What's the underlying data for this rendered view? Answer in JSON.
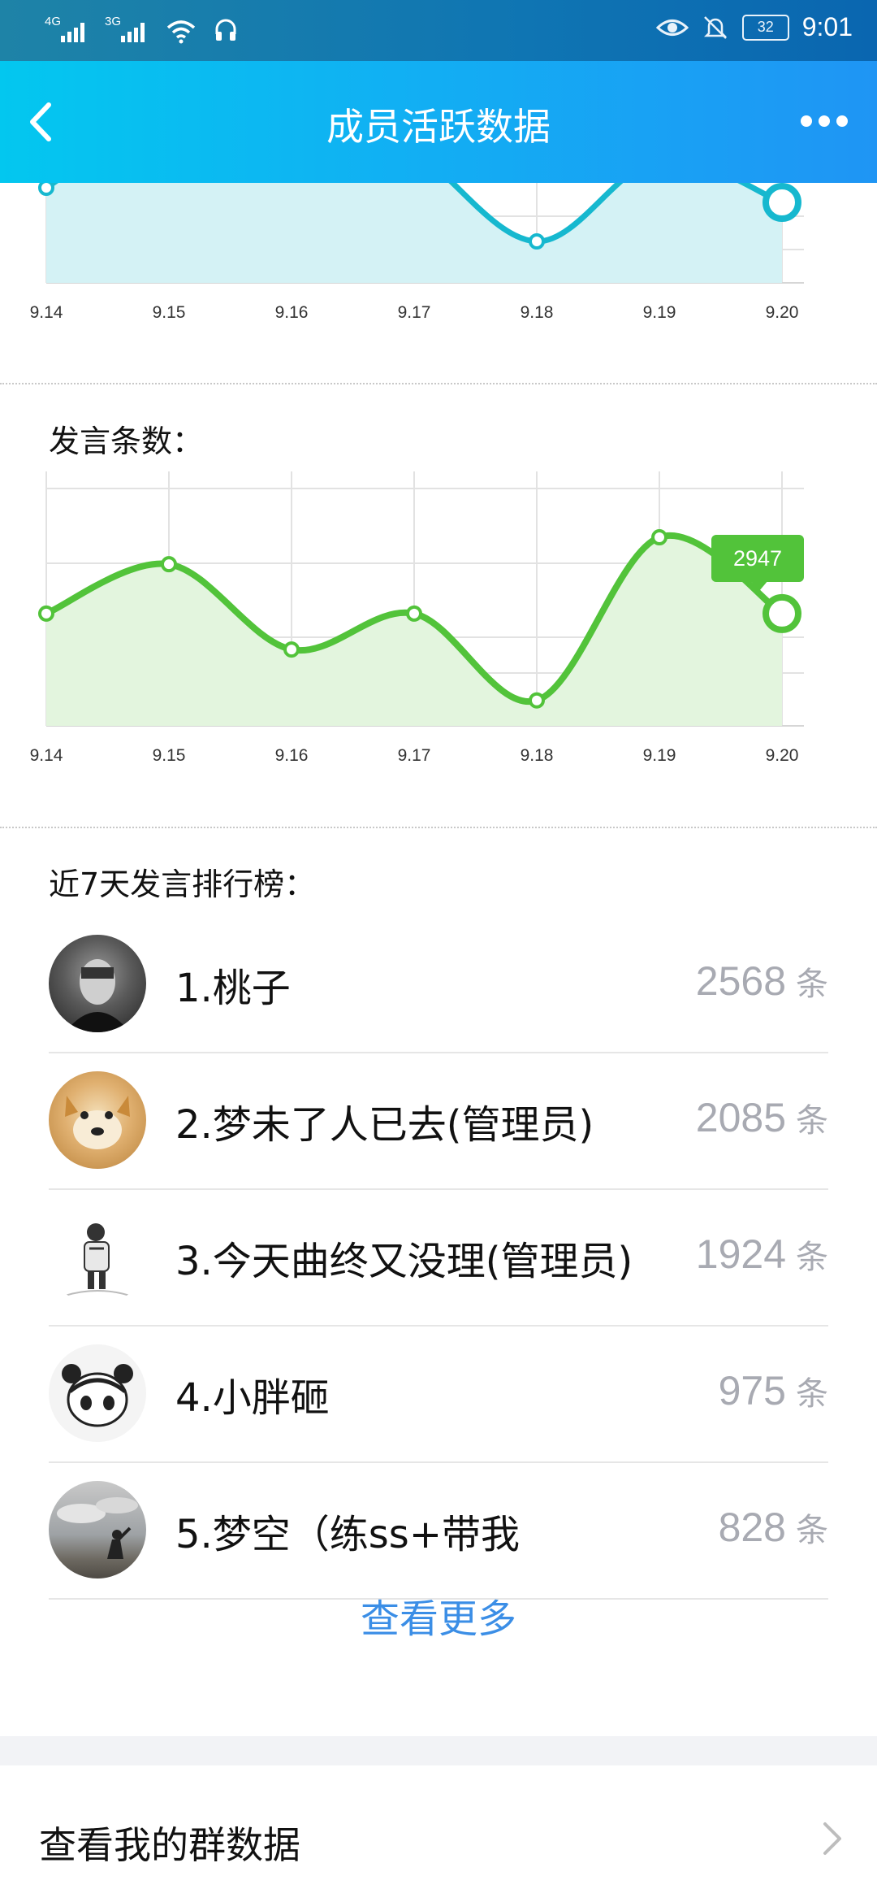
{
  "status_bar": {
    "sim1": "4G",
    "sim2": "3G",
    "battery": "32",
    "time": "9:01"
  },
  "header": {
    "title": "成员活跃数据"
  },
  "charts": {
    "x_labels": [
      "9.14",
      "9.15",
      "9.16",
      "9.17",
      "9.18",
      "9.19",
      "9.20"
    ]
  },
  "chart_data": [
    {
      "type": "area",
      "title": "",
      "categories": [
        "9.14",
        "9.15",
        "9.16",
        "9.17",
        "9.18",
        "9.19",
        "9.20"
      ],
      "partially_visible": true,
      "series": [
        {
          "values": [
            null,
            null,
            null,
            null,
            null,
            null,
            null
          ]
        }
      ],
      "colors": {
        "line": "#16b8cf",
        "fill": "#d4f2f5"
      }
    },
    {
      "type": "area",
      "title": "发言条数：",
      "categories": [
        "9.14",
        "9.15",
        "9.16",
        "9.17",
        "9.18",
        "9.19",
        "9.20"
      ],
      "series": [
        {
          "values": [
            2500,
            2830,
            2260,
            2500,
            1920,
            3010,
            2500
          ]
        }
      ],
      "highlight": {
        "category": "9.20",
        "label": "2947"
      },
      "ylim": [
        1750,
        3450
      ],
      "colors": {
        "line": "#52c33a",
        "fill": "#e3f5de",
        "tooltip": "#52c33a"
      }
    }
  ],
  "ranking": {
    "title": "近7天发言排行榜：",
    "unit": "条",
    "items": [
      {
        "name": "1.桃子",
        "count": "2568"
      },
      {
        "name": "2.梦未了人已去(管理员)",
        "count": "2085"
      },
      {
        "name": "3.今天曲终又没理(管理员)",
        "count": "1924"
      },
      {
        "name": "4.小胖砸",
        "count": "975"
      },
      {
        "name": "5.梦空（练ss+带我",
        "count": "828"
      }
    ],
    "more_label": "查看更多"
  },
  "footer": {
    "label": "查看我的群数据"
  }
}
